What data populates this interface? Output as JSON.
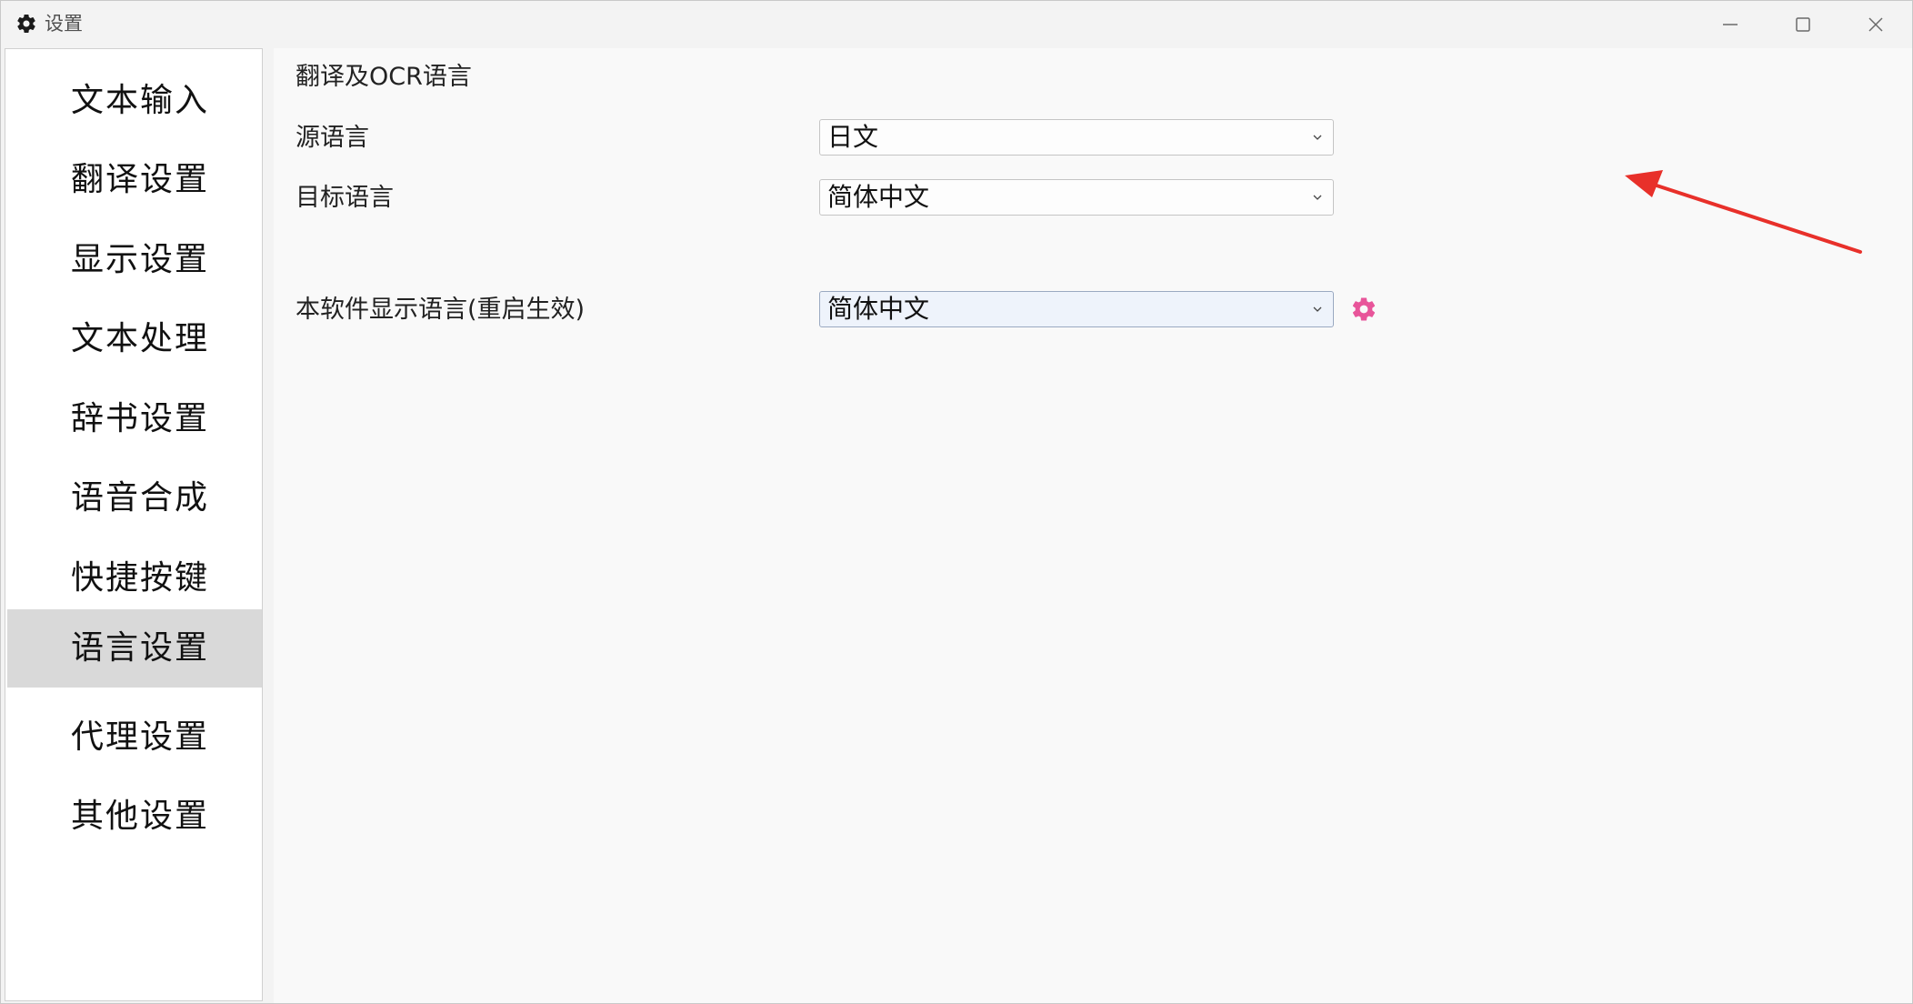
{
  "window": {
    "title": "设置",
    "icon": "gear-icon",
    "controls": [
      "minimize-icon",
      "maximize-icon",
      "close-icon"
    ]
  },
  "sidebar": {
    "items": [
      {
        "label": "文本输入"
      },
      {
        "label": "翻译设置"
      },
      {
        "label": "显示设置"
      },
      {
        "label": "文本处理"
      },
      {
        "label": "辞书设置"
      },
      {
        "label": "语音合成"
      },
      {
        "label": "快捷按键"
      },
      {
        "label": "语言设置",
        "active": true
      },
      {
        "label": "代理设置"
      },
      {
        "label": "其他设置"
      }
    ]
  },
  "main": {
    "section_title": "翻译及OCR语言",
    "source_language": {
      "label": "源语言",
      "value": "日文"
    },
    "target_language": {
      "label": "目标语言",
      "value": "简体中文"
    },
    "ui_language": {
      "label": "本软件显示语言(重启生效)",
      "value": "简体中文",
      "settings_icon": "gear-icon"
    }
  },
  "colors": {
    "accent_pink": "#e8559a",
    "annotation_red": "#e8302a",
    "active_item": "#d9d9d9"
  }
}
